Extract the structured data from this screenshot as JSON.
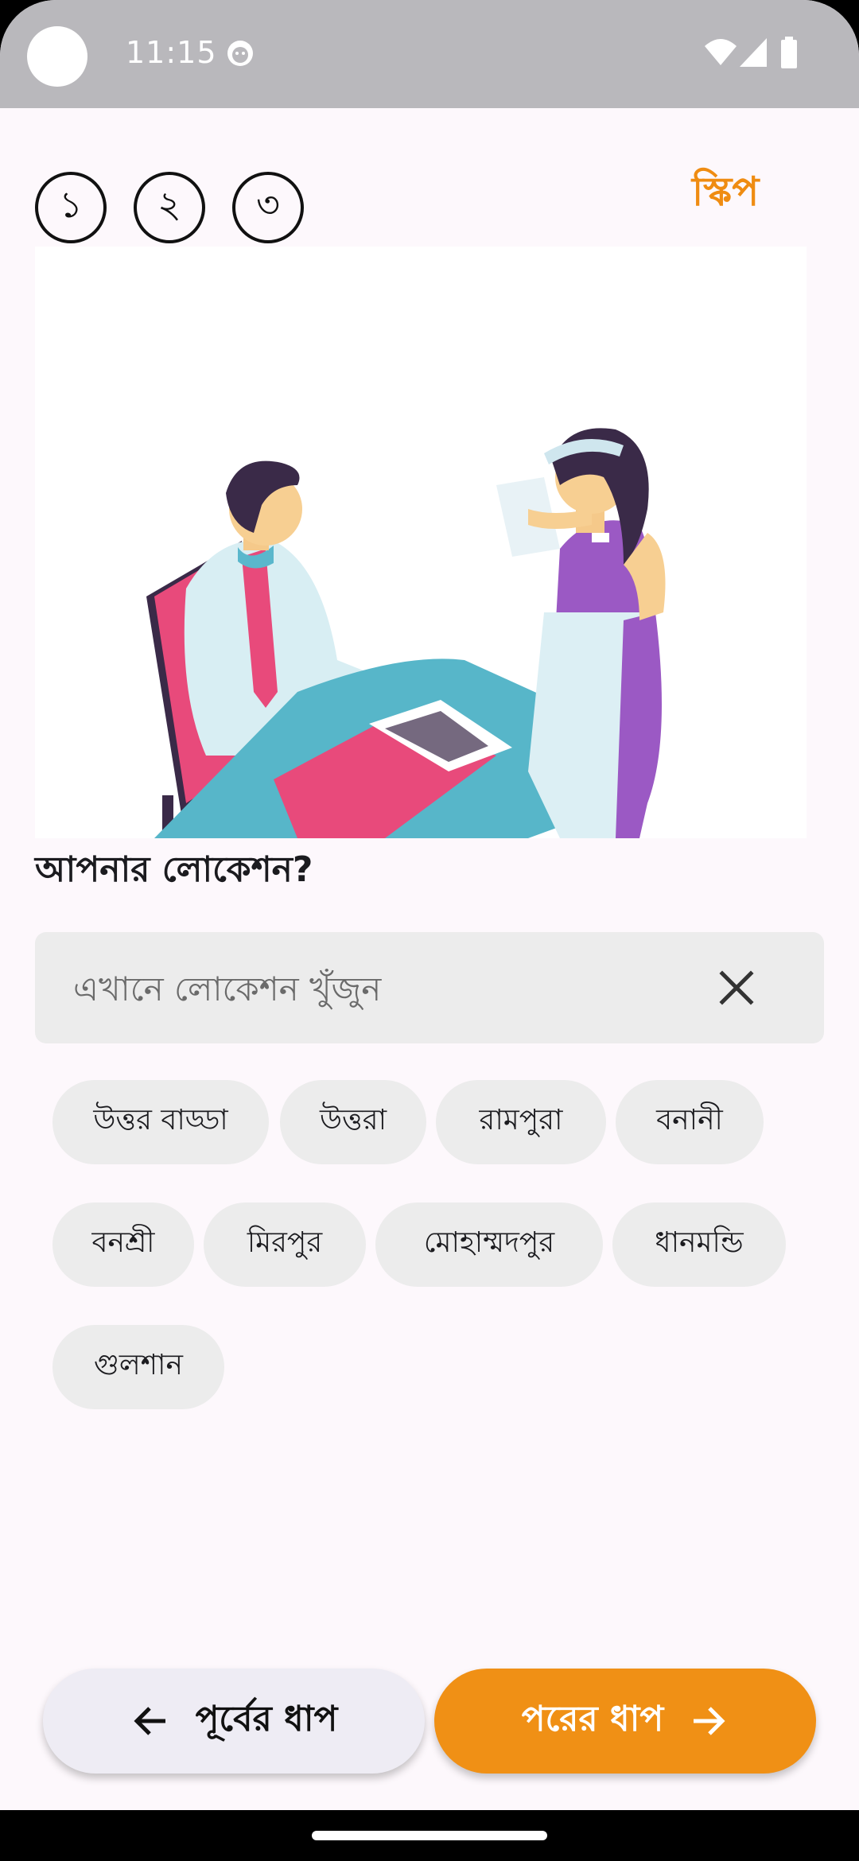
{
  "status_bar": {
    "time": "11:15"
  },
  "steps": [
    "১",
    "২",
    "৩"
  ],
  "header": {
    "skip_label": "স্কিপ"
  },
  "question": "আপনার লোকেশন?",
  "search": {
    "placeholder": "এখানে লোকেশন খুঁজুন",
    "value": ""
  },
  "locations": [
    "উত্তর বাড্ডা",
    "উত্তরা",
    "রামপুরা",
    "বনানী",
    "বনশ্রী",
    "মিরপুর",
    "মোহাম্মদপুর",
    "ধানমন্ডি",
    "গুলশান"
  ],
  "footer": {
    "prev_label": "পূর্বের ধাপ",
    "next_label": "পরের ধাপ"
  },
  "colors": {
    "accent": "#F09015",
    "chip": "#ECECEC",
    "background": "#FDF8FC"
  }
}
